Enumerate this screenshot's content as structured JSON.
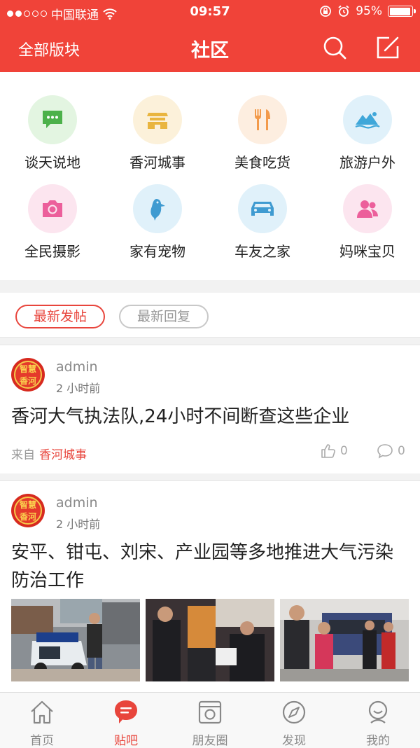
{
  "status_bar": {
    "carrier": "中国联通",
    "time": "09:57",
    "battery": "95%",
    "battery_level": 0.95
  },
  "nav": {
    "left_label": "全部版块",
    "title": "社区",
    "icons": [
      "search-icon",
      "compose-icon"
    ]
  },
  "categories": [
    {
      "label": "谈天说地",
      "icon": "chat-icon",
      "bg": "#e3f5e1",
      "color": "#4cb14a"
    },
    {
      "label": "香河城事",
      "icon": "gate-icon",
      "bg": "#fcf1da",
      "color": "#e9b53f"
    },
    {
      "label": "美食吃货",
      "icon": "fork-knife-icon",
      "bg": "#fdeee0",
      "color": "#f39a4a"
    },
    {
      "label": "旅游户外",
      "icon": "landscape-icon",
      "bg": "#e0f1fa",
      "color": "#3fa7d9"
    },
    {
      "label": "全民摄影",
      "icon": "camera-icon",
      "bg": "#fce5ef",
      "color": "#ec5f9b"
    },
    {
      "label": "家有宠物",
      "icon": "bird-icon",
      "bg": "#e0f1fa",
      "color": "#3f9bd1"
    },
    {
      "label": "车友之家",
      "icon": "car-icon",
      "bg": "#e0f1fa",
      "color": "#3f9bd1"
    },
    {
      "label": "妈咪宝贝",
      "icon": "people-icon",
      "bg": "#fce5ef",
      "color": "#ec5f9b"
    }
  ],
  "tabs": [
    {
      "label": "最新发帖",
      "active": true
    },
    {
      "label": "最新回复",
      "active": false
    }
  ],
  "posts": [
    {
      "author": "admin",
      "time": "2 小时前",
      "title": "香河大气执法队,24小时不间断查这些企业",
      "from_prefix": "来自",
      "source": "香河城事",
      "likes": "0",
      "comments": "0",
      "avatar_text": "智慧香河"
    },
    {
      "author": "admin",
      "time": "2 小时前",
      "title": "安平、钳屯、刘宋、产业园等多地推进大气污染防治工作",
      "avatar_text": "智慧香河"
    }
  ],
  "tabbar": [
    {
      "label": "首页",
      "icon": "home-icon",
      "active": false
    },
    {
      "label": "贴吧",
      "icon": "message-bubble-icon",
      "active": true
    },
    {
      "label": "朋友圈",
      "icon": "camera-frame-icon",
      "active": false
    },
    {
      "label": "发现",
      "icon": "compass-icon",
      "active": false
    },
    {
      "label": "我的",
      "icon": "user-icon",
      "active": false
    }
  ],
  "colors": {
    "brand_red": "#f04339",
    "accent_red": "#e8453c"
  }
}
